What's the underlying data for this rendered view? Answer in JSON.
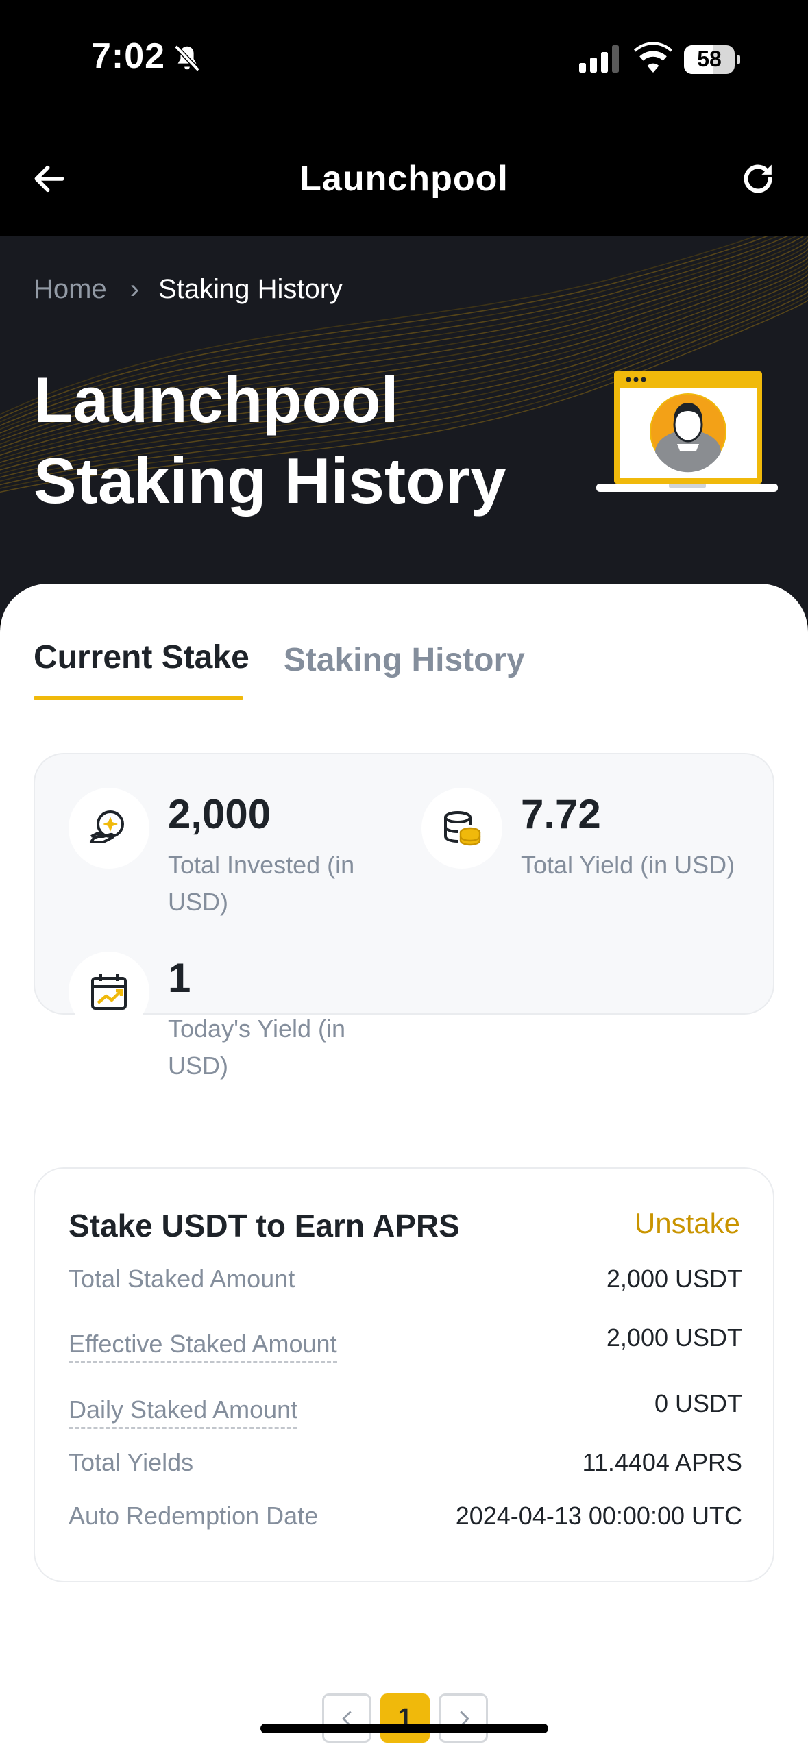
{
  "status_bar": {
    "time": "7:02",
    "battery": "58",
    "battery_level": 0.58
  },
  "nav": {
    "title": "Launchpool"
  },
  "breadcrumb": {
    "home": "Home",
    "separator": "›",
    "current": "Staking History"
  },
  "hero": {
    "title": "Launchpool Staking History"
  },
  "tabs": [
    {
      "label": "Current Stake",
      "active": true
    },
    {
      "label": "Staking History",
      "active": false
    }
  ],
  "summary": {
    "total_invested": {
      "value": "2,000",
      "label": "Total Invested (in USD)"
    },
    "total_yield": {
      "value": "7.72",
      "label": "Total Yield (in USD)"
    },
    "todays_yield": {
      "value": "1",
      "label": "Today's Yield (in USD)"
    }
  },
  "stake": {
    "title": "Stake USDT to Earn APRS",
    "unstake_label": "Unstake",
    "rows": [
      {
        "label": "Total Staked Amount",
        "value": "2,000 USDT"
      },
      {
        "label": "Effective Staked Amount",
        "value": "2,000 USDT"
      },
      {
        "label": "Daily Staked Amount",
        "value": "0 USDT"
      },
      {
        "label": "Total Yields",
        "value": "11.4404 APRS"
      },
      {
        "label": "Auto Redemption Date",
        "value": "2024-04-13 00:00:00 UTC"
      }
    ]
  },
  "pagination": {
    "current_page": "1"
  },
  "colors": {
    "accent": "#f0b90b",
    "link": "#c99400",
    "hero_bg": "#181a20"
  }
}
